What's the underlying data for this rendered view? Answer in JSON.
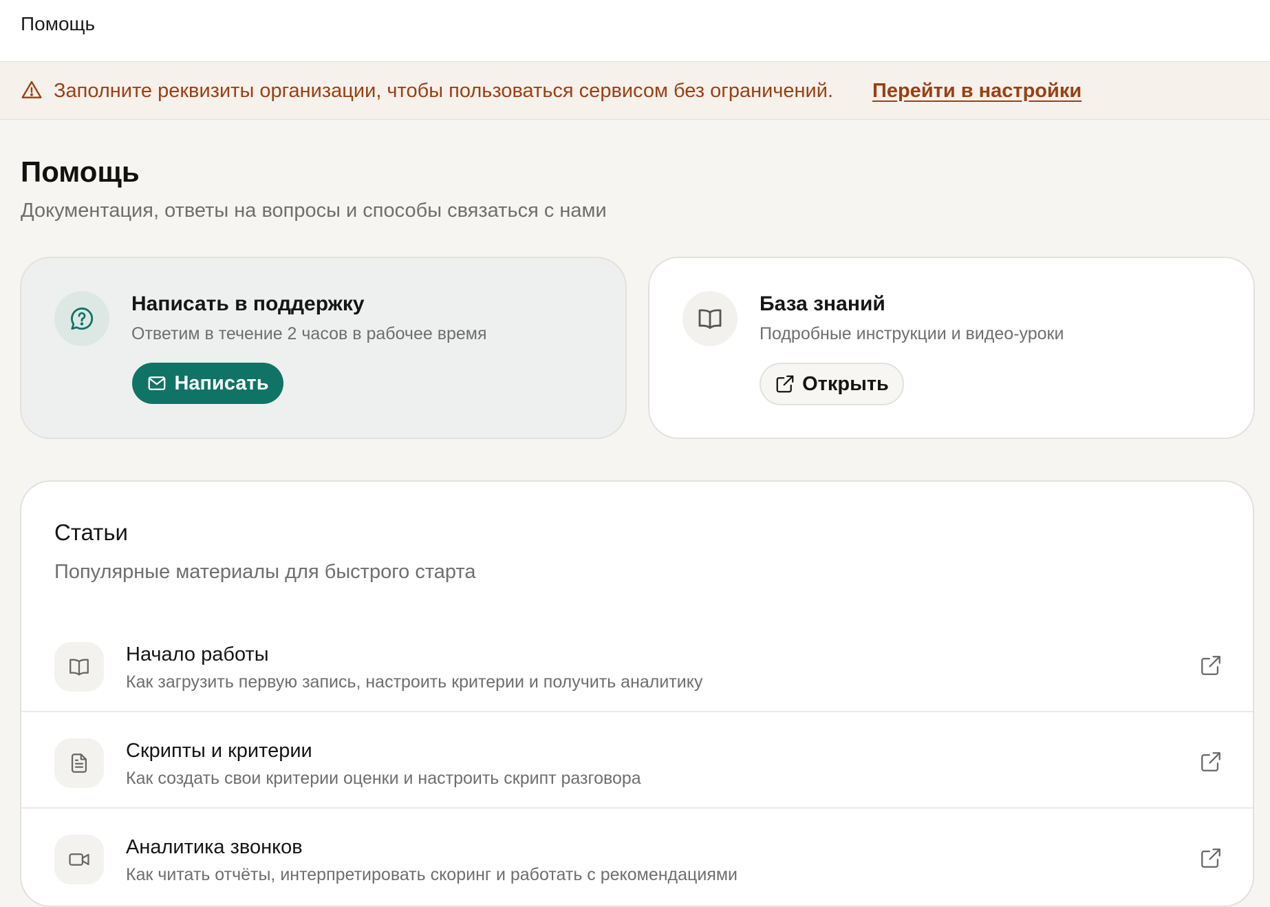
{
  "topbar": {
    "title": "Помощь"
  },
  "banner": {
    "icon": "warning-triangle-icon",
    "text": "Заполните реквизиты организации, чтобы пользоваться сервисом без ограничений.",
    "link": "Перейти в настройки",
    "color": "#9a3f12"
  },
  "header": {
    "title": "Помощь",
    "subtitle": "Документация, ответы на вопросы и способы связаться с нами"
  },
  "cards": {
    "support": {
      "icon": "question-chat-icon",
      "title": "Написать в поддержку",
      "subtitle": "Ответим в течение 2 часов в рабочее время",
      "button": "Написать",
      "button_icon": "mail-icon",
      "accent": "#0f7466"
    },
    "knowledge": {
      "icon": "book-icon",
      "title": "База знаний",
      "subtitle": "Подробные инструкции и видео-уроки",
      "button": "Открыть",
      "button_icon": "external-link-icon"
    }
  },
  "articles": {
    "title": "Статьи",
    "subtitle": "Популярные материалы для быстрого старта",
    "items": [
      {
        "icon": "book-icon",
        "title": "Начало работы",
        "description": "Как загрузить первую запись, настроить критерии и получить аналитику"
      },
      {
        "icon": "document-icon",
        "title": "Скрипты и критерии",
        "description": "Как создать свои критерии оценки и настроить скрипт разговора"
      },
      {
        "icon": "video-icon",
        "title": "Аналитика звонков",
        "description": "Как читать отчёты, интерпретировать скоринг и работать с рекомендациями"
      }
    ]
  }
}
